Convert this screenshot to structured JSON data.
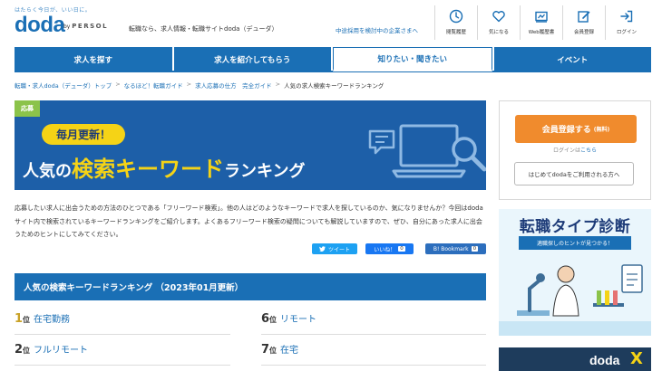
{
  "header": {
    "tagline": "はたらく今日が、いい日に。",
    "logo": "doda",
    "by": "by",
    "persol": "PERSOL",
    "description": "転職なら、求人情報・転職サイトdoda（デューダ）",
    "employer_link": "中途採用を検討中の企業さまへ",
    "icons": [
      {
        "label": "閲覧履歴",
        "icon": "clock-icon"
      },
      {
        "label": "気になる",
        "icon": "heart-icon"
      },
      {
        "label": "Web履歴書",
        "icon": "resume-icon"
      },
      {
        "label": "会員登録",
        "icon": "edit-icon"
      },
      {
        "label": "ログイン",
        "icon": "login-icon"
      }
    ]
  },
  "nav": {
    "tabs": [
      {
        "label": "求人を探す"
      },
      {
        "label": "求人を紹介してもらう"
      },
      {
        "label": "知りたい・聞きたい"
      },
      {
        "label": "イベント"
      }
    ],
    "active_index": 2
  },
  "breadcrumb": {
    "items": [
      "転職・求人doda（デューダ）トップ",
      "なるほど！転職ガイド",
      "求人応募の仕方　完全ガイド"
    ],
    "separator": ">",
    "current": "人気の求人検索キーワードランキング"
  },
  "hero": {
    "badge": "応募",
    "pill": "毎月更新！",
    "title_1": "人気の",
    "title_2": "検索キーワード",
    "title_3": "ランキング"
  },
  "intro": {
    "text": "応募したい求人に出会うための方法のひとつである「フリーワード検索」。他の人はどのようなキーワードで求人を探しているのか、気になりませんか？今回はdodaサイト内で検索されているキーワードランキングをご紹介します。よくあるフリーワード検索の疑問についても解説していますので、ぜひ、自分にあった求人に出会うためのヒントにしてみてください。"
  },
  "share": {
    "tweet": "ツイート",
    "like": "いいね！",
    "like_count": "0",
    "bookmark": "B! Bookmark",
    "bookmark_count": "0"
  },
  "ranking": {
    "title": "人気の検索キーワードランキング （2023年01月更新）",
    "rank_suffix": "位",
    "items": [
      {
        "rank": "1",
        "keyword": "在宅勤務"
      },
      {
        "rank": "2",
        "keyword": "フルリモート"
      },
      {
        "rank": "6",
        "keyword": "リモート"
      },
      {
        "rank": "7",
        "keyword": "在宅"
      }
    ]
  },
  "sidebar": {
    "register_label": "会員登録する",
    "register_free": "(無料)",
    "login_text": "ログインは",
    "login_link": "こちら",
    "first_time": "はじめてdodaをご利用される方へ",
    "ad1_title": "転職タイプ診断",
    "ad1_ribbon": "適職探しのヒントが見つかる！",
    "ad2_logo": "doda",
    "ad2_x": "X"
  },
  "colors": {
    "brand_blue": "#1a6fb5",
    "hero_blue": "#1d5fa8",
    "accent_yellow": "#f5d316",
    "register_orange": "#f08b2d",
    "badge_green": "#8bc34a"
  }
}
